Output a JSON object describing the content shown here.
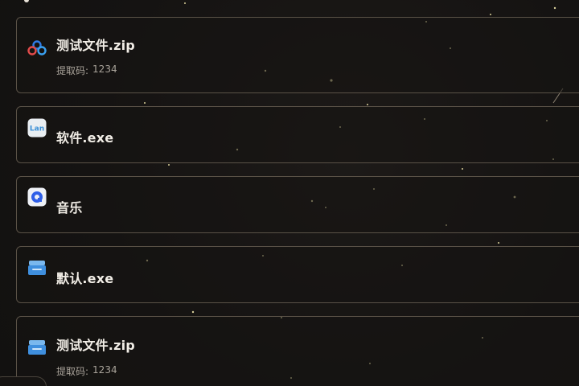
{
  "items": [
    {
      "title": "测试文件.zip",
      "code_label": "提取码:",
      "code": "1234",
      "icon": "baidu-netdisk-icon"
    },
    {
      "title": "软件.exe",
      "icon": "lanzou-cloud-icon"
    },
    {
      "title": "音乐",
      "icon": "quark-drive-icon"
    },
    {
      "title": "默认.exe",
      "icon": "default-drive-icon"
    },
    {
      "title": "测试文件.zip",
      "code_label": "提取码:",
      "code": "1234",
      "icon": "default-drive-icon"
    }
  ],
  "colors": {
    "background": "#151312",
    "card_border": "#5a5247",
    "title_text": "#f1ede6",
    "code_text": "#a9a39a"
  }
}
